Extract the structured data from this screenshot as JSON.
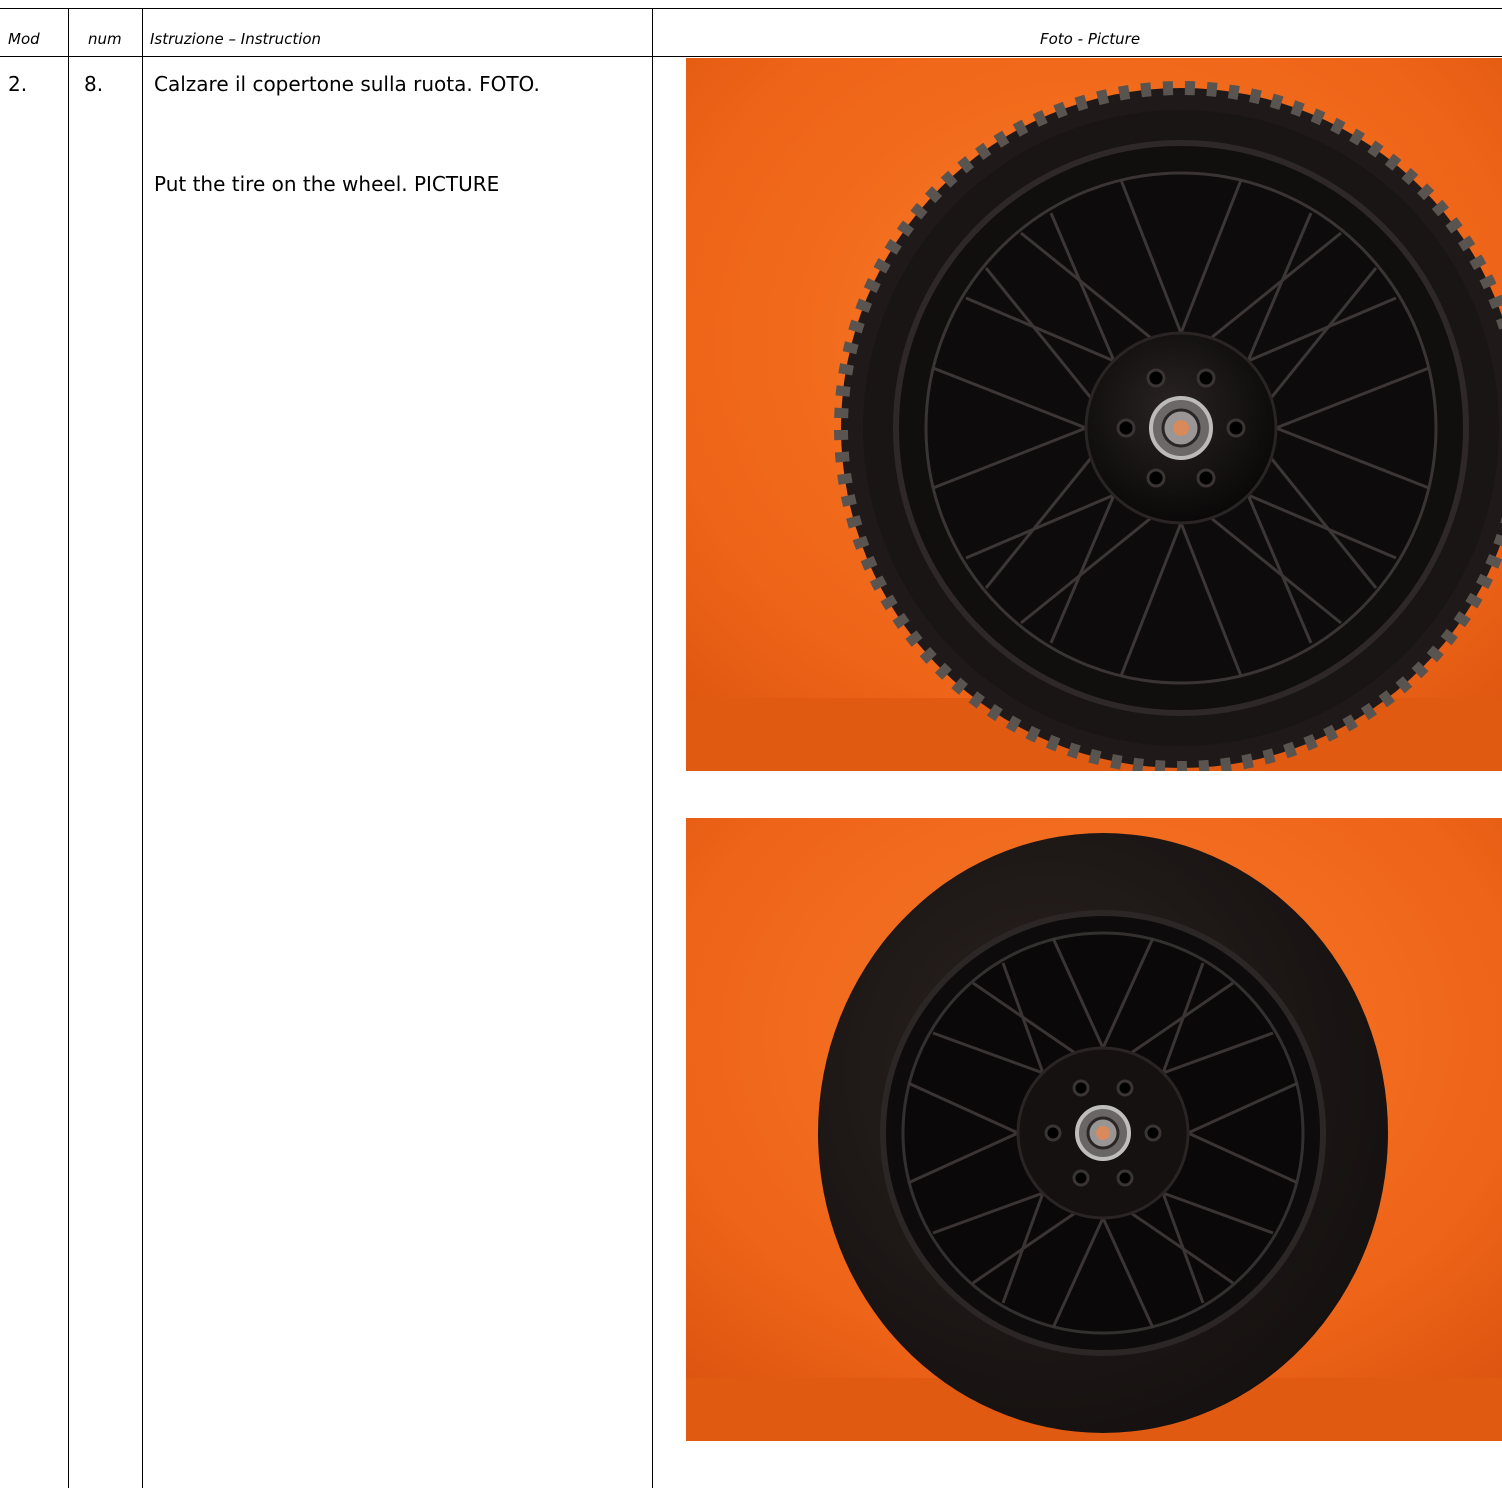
{
  "header": {
    "mod": "Mod",
    "num": "num",
    "instruction": "Istruzione – Instruction",
    "picture": "Foto - Picture"
  },
  "row": {
    "mod": "2.",
    "num": "8.",
    "instruction_it": "Calzare il copertone sulla ruota. FOTO.",
    "instruction_en": "Put the tire on the wheel. PICTURE"
  },
  "colors": {
    "background_orange": "#f0661a",
    "tire": "#1c1615",
    "rim": "#0d0b0b"
  }
}
